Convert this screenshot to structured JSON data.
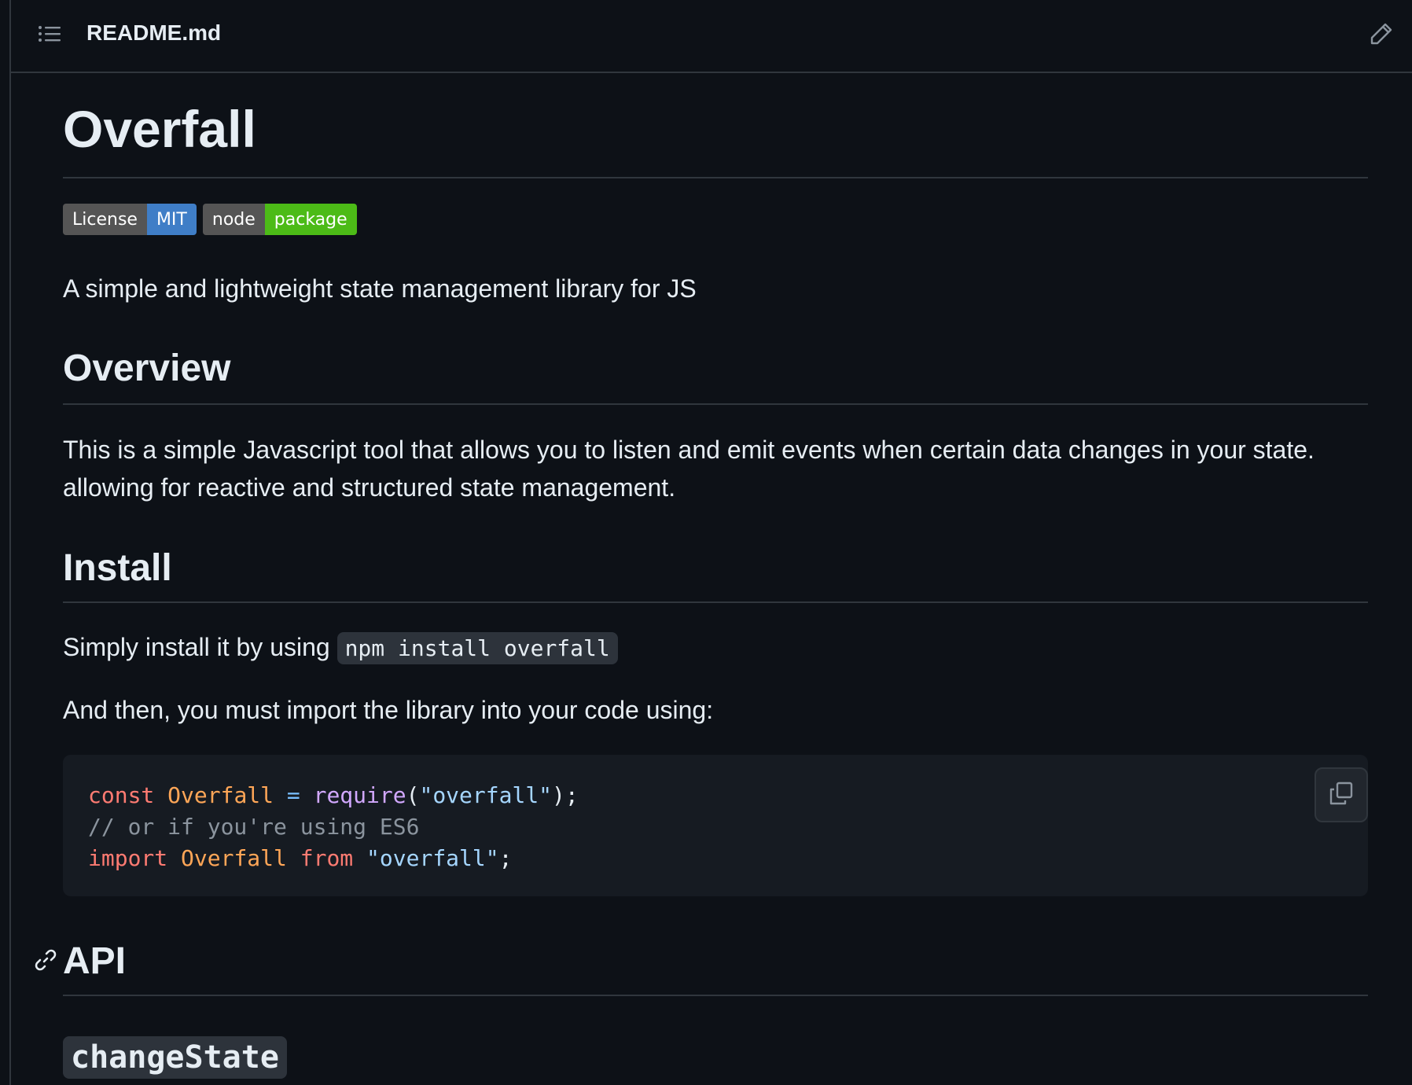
{
  "header": {
    "file_name": "README.md",
    "toc_icon": "list-unordered-icon",
    "edit_icon": "pencil-icon"
  },
  "readme": {
    "title": "Overfall",
    "badges": [
      {
        "label": "License",
        "value": "MIT",
        "color": "#3f7ec7"
      },
      {
        "label": "node",
        "value": "package",
        "color": "#4cbb17"
      }
    ],
    "tagline": "A simple and lightweight state management library for JS",
    "overview": {
      "heading": "Overview",
      "body": "This is a simple Javascript tool that allows you to listen and emit events when certain data changes in your state. allowing for reactive and structured state management."
    },
    "install": {
      "heading": "Install",
      "line1_prefix": "Simply install it by using",
      "line1_code": "npm install overfall",
      "line2": "And then, you must import the library into your code using:",
      "code_lines": [
        "const Overfall = require(\"overfall\");",
        "// or if you're using ES6",
        "import Overfall from \"overfall\";"
      ],
      "copy_icon": "copy-icon"
    },
    "api": {
      "heading": "API",
      "anchor_icon": "link-icon",
      "subheading": "changeState"
    }
  }
}
